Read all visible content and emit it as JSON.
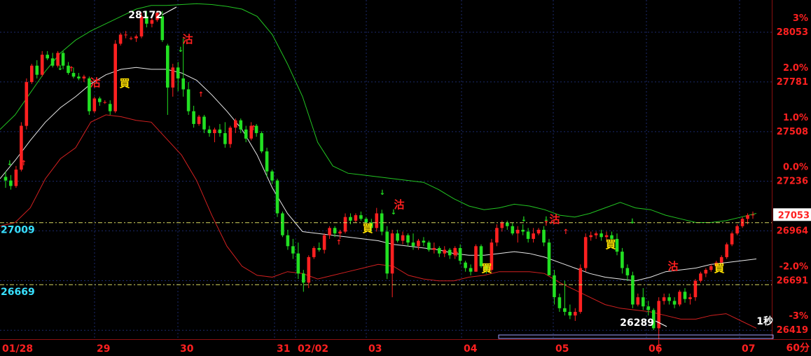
{
  "chart_data": {
    "type": "candlestick",
    "timeframe_label": "60分",
    "speed_label": "1秒",
    "colors": {
      "background": "#000000",
      "grid": "#1b2a6b",
      "up": "#ff2020",
      "down": "#22e022",
      "upper_band": "#22c422",
      "lower_band": "#d22020",
      "middle_line": "#e8e8e8",
      "price_axis_text": "#ff2020",
      "ref_line": "#d8d860",
      "ref_label": "#38e0ff",
      "marker_yellow": "#ffe000"
    },
    "y_axis": {
      "price_ticks": [
        28053,
        27781,
        27508,
        27236,
        26964,
        26691,
        26419
      ],
      "pct_ticks": [
        "3%",
        "2.0%",
        "1.0%",
        "0.0%",
        "-1.0%",
        "-2.0%",
        "-3%"
      ],
      "ylim": [
        26370,
        28230
      ]
    },
    "x_axis": {
      "date_labels": [
        "01/28",
        "29",
        "30",
        "31",
        "02/02",
        "03",
        "04",
        "05",
        "06",
        "07"
      ]
    },
    "current_price": 27053,
    "ref_levels": [
      27009,
      26669
    ],
    "annotations": {
      "high": "28172",
      "low": "26289"
    },
    "signals": {
      "sell": "沽",
      "buy": "買"
    },
    "candles": [
      [
        27260,
        27290,
        27200,
        27240
      ],
      [
        27240,
        27270,
        27190,
        27210
      ],
      [
        27210,
        27320,
        27200,
        27300
      ],
      [
        27300,
        27560,
        27290,
        27540
      ],
      [
        27540,
        27800,
        27520,
        27780
      ],
      [
        27780,
        27880,
        27770,
        27870
      ],
      [
        27870,
        27900,
        27800,
        27820
      ],
      [
        27820,
        27950,
        27810,
        27930
      ],
      [
        27930,
        27950,
        27900,
        27910
      ],
      [
        27910,
        27940,
        27860,
        27870
      ],
      [
        27870,
        27950,
        27860,
        27940
      ],
      [
        27940,
        27950,
        27850,
        27870
      ],
      [
        27870,
        27890,
        27820,
        27830
      ],
      [
        27830,
        27860,
        27800,
        27810
      ],
      [
        27810,
        27830,
        27790,
        27800
      ],
      [
        27800,
        27820,
        27780,
        27810
      ],
      [
        27800,
        27810,
        27600,
        27620
      ],
      [
        27620,
        27700,
        27610,
        27690
      ],
      [
        27690,
        27700,
        27650,
        27670
      ],
      [
        27670,
        27680,
        27660,
        27670
      ],
      [
        27660,
        27680,
        27600,
        27620
      ],
      [
        27620,
        28010,
        27610,
        27990
      ],
      [
        27990,
        28050,
        27980,
        28040
      ],
      [
        28040,
        28060,
        28020,
        28040
      ],
      [
        28020,
        28030,
        28010,
        28020
      ],
      [
        28020,
        28040,
        28000,
        28030
      ],
      [
        28030,
        28160,
        28020,
        28140
      ],
      [
        28140,
        28170,
        28080,
        28100
      ],
      [
        28100,
        28130,
        28080,
        28120
      ],
      [
        28120,
        28172,
        28110,
        28160
      ],
      [
        28140,
        28170,
        28000,
        28010
      ],
      [
        27980,
        27990,
        27600,
        27750
      ],
      [
        27750,
        27880,
        27700,
        27860
      ],
      [
        27860,
        27890,
        27730,
        27800
      ],
      [
        27800,
        28020,
        27700,
        27740
      ],
      [
        27740,
        27780,
        27600,
        27620
      ],
      [
        27620,
        27650,
        27530,
        27550
      ],
      [
        27550,
        27600,
        27540,
        27590
      ],
      [
        27590,
        27600,
        27500,
        27520
      ],
      [
        27520,
        27540,
        27480,
        27500
      ],
      [
        27500,
        27530,
        27450,
        27520
      ],
      [
        27520,
        27550,
        27480,
        27500
      ],
      [
        27500,
        27560,
        27420,
        27440
      ],
      [
        27440,
        27540,
        27420,
        27530
      ],
      [
        27530,
        27580,
        27500,
        27570
      ],
      [
        27570,
        27580,
        27500,
        27520
      ],
      [
        27520,
        27540,
        27450,
        27470
      ],
      [
        27470,
        27560,
        27460,
        27540
      ],
      [
        27540,
        27550,
        27480,
        27500
      ],
      [
        27500,
        27510,
        27390,
        27400
      ],
      [
        27400,
        27420,
        27260,
        27290
      ],
      [
        27290,
        27300,
        27220,
        27240
      ],
      [
        27240,
        27250,
        27040,
        27060
      ],
      [
        27060,
        27070,
        26930,
        26940
      ],
      [
        26940,
        26970,
        26860,
        26880
      ],
      [
        26880,
        26920,
        26810,
        26840
      ],
      [
        26840,
        26900,
        26700,
        26730
      ],
      [
        26730,
        26750,
        26630,
        26680
      ],
      [
        26680,
        26830,
        26650,
        26820
      ],
      [
        26820,
        26880,
        26810,
        26870
      ],
      [
        26870,
        26900,
        26850,
        26860
      ],
      [
        26860,
        26950,
        26840,
        26940
      ],
      [
        26940,
        26990,
        26920,
        26980
      ],
      [
        26980,
        26990,
        26930,
        26950
      ],
      [
        26950,
        26970,
        26920,
        26960
      ],
      [
        26960,
        27060,
        26950,
        27040
      ],
      [
        27040,
        27060,
        27000,
        27020
      ],
      [
        27020,
        27060,
        27010,
        27050
      ],
      [
        27050,
        27070,
        27020,
        27030
      ],
      [
        27030,
        27040,
        27000,
        27010
      ],
      [
        27010,
        27030,
        26960,
        26980
      ],
      [
        26980,
        27090,
        26960,
        27060
      ],
      [
        27060,
        27080,
        26940,
        26960
      ],
      [
        26960,
        26990,
        26700,
        26730
      ],
      [
        26730,
        26970,
        26600,
        26950
      ],
      [
        26950,
        26970,
        26900,
        26910
      ],
      [
        26910,
        26960,
        26890,
        26940
      ],
      [
        26940,
        26950,
        26880,
        26900
      ],
      [
        26900,
        26950,
        26860,
        26880
      ],
      [
        26880,
        26920,
        26860,
        26910
      ],
      [
        26910,
        26930,
        26880,
        26900
      ],
      [
        26900,
        26910,
        26850,
        26860
      ],
      [
        26860,
        26900,
        26840,
        26870
      ],
      [
        26870,
        26880,
        26820,
        26840
      ],
      [
        26840,
        26880,
        26820,
        26860
      ],
      [
        26860,
        26870,
        26810,
        26830
      ],
      [
        26830,
        26880,
        26810,
        26870
      ],
      [
        26870,
        26890,
        26780,
        26800
      ],
      [
        26790,
        26800,
        26740,
        26760
      ],
      [
        26760,
        26780,
        26720,
        26740
      ],
      [
        26740,
        26890,
        26740,
        26880
      ],
      [
        26880,
        26890,
        26760,
        26770
      ],
      [
        26770,
        26780,
        26730,
        26750
      ],
      [
        26750,
        26920,
        26740,
        26900
      ],
      [
        26900,
        27000,
        26880,
        26980
      ],
      [
        26980,
        27020,
        26960,
        27010
      ],
      [
        27010,
        27020,
        26970,
        26990
      ],
      [
        26990,
        27010,
        26940,
        26950
      ],
      [
        26950,
        26990,
        26900,
        26970
      ],
      [
        26970,
        27000,
        26940,
        26960
      ],
      [
        26960,
        26980,
        26900,
        26920
      ],
      [
        26920,
        26980,
        26900,
        26950
      ],
      [
        26950,
        26980,
        26940,
        26970
      ],
      [
        26970,
        26990,
        26880,
        26900
      ],
      [
        26900,
        26920,
        26800,
        26720
      ],
      [
        26720,
        26750,
        26560,
        26600
      ],
      [
        26600,
        26620,
        26520,
        26540
      ],
      [
        26540,
        26690,
        26500,
        26520
      ],
      [
        26520,
        26560,
        26480,
        26500
      ],
      [
        26500,
        26540,
        26470,
        26520
      ],
      [
        26520,
        26780,
        26510,
        26760
      ],
      [
        26760,
        26950,
        26740,
        26930
      ],
      [
        26930,
        26960,
        26910,
        26940
      ],
      [
        26940,
        26960,
        26920,
        26950
      ],
      [
        26950,
        26970,
        26910,
        26930
      ],
      [
        26930,
        26960,
        26910,
        26940
      ],
      [
        26940,
        26960,
        26900,
        26920
      ],
      [
        26920,
        26950,
        26830,
        26850
      ],
      [
        26850,
        26870,
        26730,
        26760
      ],
      [
        26760,
        26780,
        26690,
        26720
      ],
      [
        26720,
        26740,
        26540,
        26560
      ],
      [
        26560,
        26620,
        26550,
        26600
      ],
      [
        26600,
        26650,
        26530,
        26550
      ],
      [
        26550,
        26580,
        26500,
        26530
      ],
      [
        26530,
        26540,
        26420,
        26430
      ],
      [
        26430,
        26600,
        26290,
        26580
      ],
      [
        26580,
        26620,
        26560,
        26600
      ],
      [
        26600,
        26620,
        26560,
        26580
      ],
      [
        26580,
        26600,
        26540,
        26560
      ],
      [
        26560,
        26640,
        26550,
        26630
      ],
      [
        26630,
        26650,
        26570,
        26590
      ],
      [
        26590,
        26620,
        26560,
        26600
      ],
      [
        26600,
        26700,
        26580,
        26690
      ],
      [
        26690,
        26740,
        26680,
        26730
      ],
      [
        26730,
        26760,
        26710,
        26750
      ],
      [
        26750,
        26780,
        26740,
        26770
      ],
      [
        26770,
        26800,
        26760,
        26790
      ],
      [
        26790,
        26830,
        26780,
        26820
      ],
      [
        26820,
        26900,
        26810,
        26890
      ],
      [
        26890,
        26960,
        26880,
        26950
      ],
      [
        26950,
        27000,
        26940,
        26990
      ],
      [
        26990,
        27040,
        26980,
        27030
      ],
      [
        27030,
        27060,
        27000,
        27050
      ],
      [
        27050,
        27070,
        27030,
        27053
      ]
    ],
    "upper_band": [
      27520,
      27600,
      27720,
      27840,
      27940,
      28010,
      28060,
      28100,
      28140,
      28180,
      28200,
      28200,
      28205,
      28210,
      28205,
      28195,
      28180,
      28140,
      28040,
      27880,
      27700,
      27450,
      27320,
      27280,
      27270,
      27260,
      27250,
      27240,
      27230,
      27190,
      27140,
      27100,
      27080,
      27090,
      27110,
      27100,
      27080,
      27050,
      27040,
      27060,
      27090,
      27120,
      27090,
      27080,
      27050,
      27030,
      27010,
      27010,
      27020,
      27040,
      27060
    ],
    "lower_band": [
      26990,
      27010,
      27090,
      27250,
      27360,
      27420,
      27560,
      27600,
      27590,
      27570,
      27560,
      27470,
      27380,
      27240,
      27050,
      26880,
      26770,
      26720,
      26710,
      26740,
      26730,
      26700,
      26720,
      26740,
      26760,
      26780,
      26770,
      26720,
      26700,
      26690,
      26690,
      26710,
      26720,
      26740,
      26740,
      26740,
      26730,
      26680,
      26640,
      26600,
      26560,
      26540,
      26530,
      26520,
      26500,
      26480,
      26480,
      26500,
      26510,
      26470,
      26430
    ],
    "middle_line": [
      27250,
      27350,
      27460,
      27560,
      27640,
      27700,
      27770,
      27820,
      27850,
      27860,
      27850,
      27850,
      27830,
      27790,
      27710,
      27620,
      27520,
      27380,
      27200,
      27060,
      26960,
      26950,
      26940,
      26930,
      26920,
      26910,
      26890,
      26880,
      26870,
      26860,
      26840,
      26830,
      26830,
      26840,
      26850,
      26840,
      26820,
      26790,
      26760,
      26730,
      26710,
      26700,
      26690,
      26710,
      26740,
      26750,
      26760,
      26780,
      26790,
      26800,
      26810
    ]
  }
}
